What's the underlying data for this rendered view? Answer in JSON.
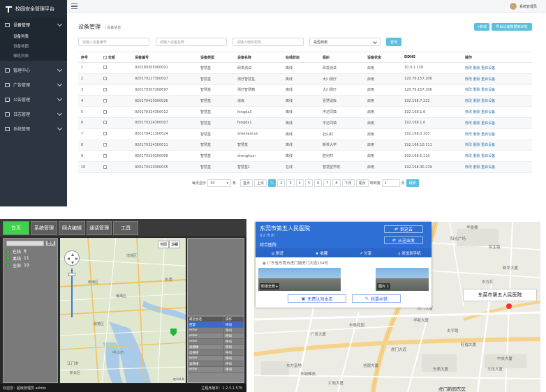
{
  "admin": {
    "app_title": "校园安全管理平台",
    "user_name": "系统管理员",
    "sidebar": [
      {
        "label": "设备管理",
        "active": true,
        "children": [
          "设备列表",
          "设备地图",
          "球机列表"
        ]
      },
      {
        "label": "管理中心"
      },
      {
        "label": "广告管理"
      },
      {
        "label": "公告管理"
      },
      {
        "label": "日志管理"
      },
      {
        "label": "系统管理"
      }
    ],
    "page_title": "设备管理",
    "breadcrumb": "/ 设备信息",
    "add_button": "+新增",
    "export_button": "导出设备数据到本地",
    "filters": {
      "device_no_placeholder": "请输入设备编号",
      "device_name_placeholder": "请输入设备名称",
      "org_placeholder": "请输入组织机构",
      "enabled_select": "是否启用",
      "query_button": "查询"
    },
    "columns": [
      "序号",
      "全部",
      "设备编号",
      "设备类型",
      "设备名称",
      "在线状态",
      "组织",
      "设备状态",
      "DDNS",
      "操作"
    ],
    "rows": [
      {
        "no": "1",
        "id": "920180305000001",
        "type": "智慧盒",
        "name": "研发测试",
        "online": "离线",
        "org": "研发测试",
        "status": "启用",
        "ddns": "10.0.1.128",
        "ops": "修改 删除 重启设备"
      },
      {
        "no": "2",
        "id": "920170227300007",
        "type": "智慧盒",
        "name": "测厅智慧盒",
        "online": "离线",
        "org": "大川测厅",
        "status": "启用",
        "ddns": "120.76.157.206",
        "ops": "修改 删除 重启设备"
      },
      {
        "no": "3",
        "id": "920170307308697",
        "type": "智慧盒",
        "name": "测厅智慧箱",
        "online": "离线",
        "org": "大川测厅",
        "status": "启用",
        "ddns": "120.76.157.206",
        "ops": "修改 删除 重启设备"
      },
      {
        "no": "4",
        "id": "920170420300026",
        "type": "智慧盒",
        "name": "道库",
        "online": "离线",
        "org": "喜慧道库",
        "status": "启用",
        "ddns": "192.168.7.222",
        "ops": "修改 删除 重启设备"
      },
      {
        "no": "5",
        "id": "920170324300012",
        "type": "智慧盒",
        "name": "fengda3",
        "online": "离线",
        "org": "丰达同填",
        "status": "启用",
        "ddns": "192.168.1.6",
        "ops": "修改 删除 重启设备"
      },
      {
        "no": "6",
        "id": "920170324300007",
        "type": "智慧盒",
        "name": "fengda1",
        "online": "离线",
        "org": "丰达同填",
        "status": "启用",
        "ddns": "192.168.1.6",
        "ops": "修改 删除 重启设备"
      },
      {
        "no": "7",
        "id": "920170411300024",
        "type": "智慧盒",
        "name": "sheshancun",
        "online": "离线",
        "org": "社山村",
        "status": "启用",
        "ddns": "192.168.0.103",
        "ops": "修改 删除 重启设备"
      },
      {
        "no": "8",
        "id": "920170324300011",
        "type": "智慧盒",
        "name": "智慧盒",
        "online": "离线",
        "org": "新校大学",
        "status": "启用",
        "ddns": "192.168.10.111",
        "ops": "修改 删除 重启设备"
      },
      {
        "no": "9",
        "id": "920170320300009",
        "type": "智慧盒",
        "name": "shengfcun",
        "online": "离线",
        "org": "胜利村",
        "status": "启用",
        "ddns": "192.168.5.110",
        "ops": "修改 删除 重启设备"
      },
      {
        "no": "10",
        "id": "920170420300045",
        "type": "智慧盒",
        "name": "智慧盒1",
        "online": "在线",
        "org": "智慧型学校",
        "status": "启用",
        "ddns": "192.168.30.219",
        "ops": "修改 删除 重启设备"
      }
    ],
    "pager": {
      "per_page_label": "每页显示",
      "per_page": "10",
      "unit": "条",
      "first": "首页",
      "prev": "上页",
      "pages": [
        "1",
        "2",
        "3",
        "4",
        "5",
        "6",
        "7",
        "8"
      ],
      "next": "下页",
      "last": "尾页",
      "jump_label": "转到第",
      "jump_value": "1",
      "page_unit": "页",
      "go": "跳转"
    }
  },
  "gis": {
    "tabs": [
      "首页",
      "系统管理",
      "网点编辑",
      "通话管理",
      "工具"
    ],
    "search_button": "查找",
    "tree": [
      {
        "label": "在线",
        "count": "8"
      },
      {
        "label": "离线",
        "count": "11"
      },
      {
        "label": "全部",
        "count": "19"
      }
    ],
    "map_buttons": [
      "地图",
      "卫视"
    ],
    "map_places": [
      "增城区",
      "东莞",
      "番禺区",
      "中山市",
      "江门市",
      "新会区",
      "顺德区",
      "南海区"
    ],
    "grid_header": [
      "最近会话",
      "操作"
    ],
    "grid_rows": [
      {
        "name": "西夏",
        "action": "呼叫"
      },
      {
        "name": "enter",
        "action": "呼叫"
      },
      {
        "name": "enter",
        "action": "呼叫"
      },
      {
        "name": "enter",
        "action": "呼叫"
      },
      {
        "name": "高德楼",
        "action": "呼叫"
      },
      {
        "name": "高德楼",
        "action": "呼叫"
      },
      {
        "name": "enter",
        "action": "呼叫"
      },
      {
        "name": "高德楼",
        "action": "呼叫"
      },
      {
        "name": "enter",
        "action": "呼叫"
      }
    ],
    "status_left": "欢迎您：超级管理员 admin",
    "status_right": "主程序版本：1.2.3.1 579",
    "map_copyright": "使用条款"
  },
  "map2": {
    "poi_name": "东莞市第五人民医院",
    "poi_rating": "3.2 (5.0)",
    "poi_category": "综合医院",
    "btn_goto": "到这去",
    "btn_from": "从这出发",
    "actions": [
      "附近",
      "收藏",
      "分享",
      "发送到手机"
    ],
    "address": "广东省东莞市虎门镇虎门大道154号",
    "photos": [
      "街道全景 ▸",
      "图片 1"
    ],
    "btn_claim": "免费认领本店",
    "btn_error": "我要纠错",
    "hospital_label": "东莞市第五人民医院",
    "places": [
      "华景楼",
      "阳光广场",
      "民生路",
      "东方红",
      "太平路",
      "虎门大道",
      "虎门新园东区",
      "中央大厦",
      "广发大厦",
      "东方富地",
      "东城雅苑",
      "汇苑大厦",
      "丰泰花园",
      "华新大厦",
      "文化大厦",
      "信德大厦",
      "虎门大厦",
      "旺福大厦",
      "新华大厦",
      "东美大厦"
    ]
  }
}
